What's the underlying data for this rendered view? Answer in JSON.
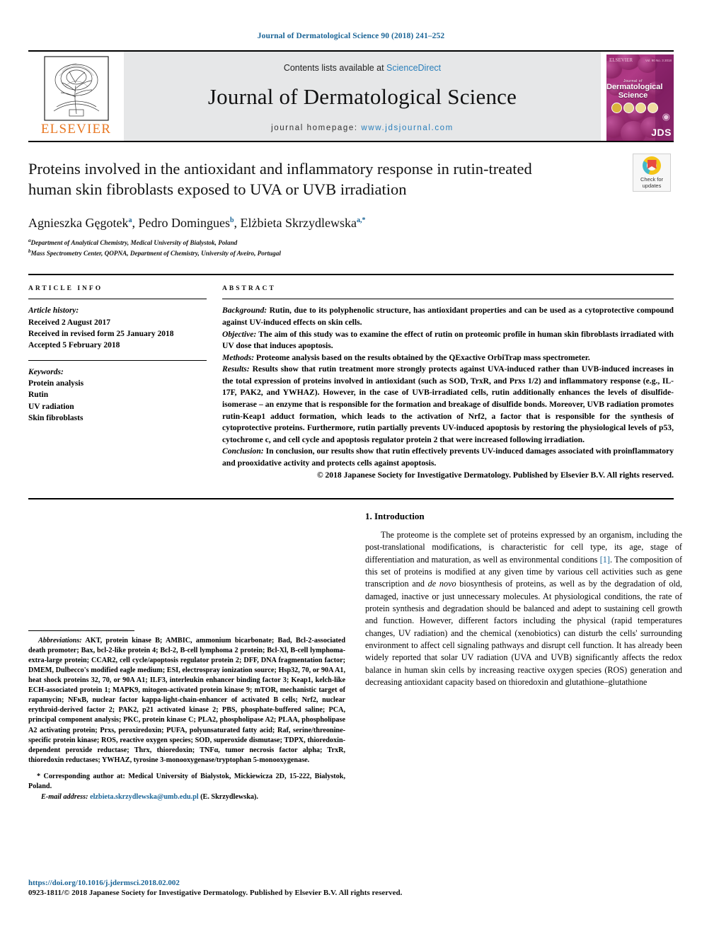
{
  "running_head": "Journal of Dermatological Science 90 (2018) 241–252",
  "masthead": {
    "publisher_name": "ELSEVIER",
    "contents_prefix": "Contents lists available at ",
    "contents_link": "ScienceDirect",
    "journal_title": "Journal of Dermatological Science",
    "homepage_prefix": "journal homepage: ",
    "homepage_url": "www.jdsjournal.com",
    "cover": {
      "title_small": "Journal of",
      "title_line1": "Dermatological",
      "title_line2": "Science",
      "acronym": "JDS",
      "publisher_small": "ELSEVIER",
      "volume_small": "Vol. 90  No. 3  2018"
    }
  },
  "article": {
    "title": "Proteins involved in the antioxidant and inflammatory response in rutin-treated human skin fibroblasts exposed to UVA or UVB irradiation",
    "crossmark_label_line1": "Check for",
    "crossmark_label_line2": "updates",
    "authors_html": "Agnieszka Gęgotek<sup>a</sup>, Pedro Domingues<sup>b</sup>, Elżbieta Skrzydlewska<sup>a,*</sup>",
    "affiliations": [
      {
        "marker": "a",
        "text": "Department of Analytical Chemistry, Medical University of Bialystok, Poland"
      },
      {
        "marker": "b",
        "text": "Mass Spectrometry Center, QOPNA, Department of Chemistry, University of Aveiro, Portugal"
      }
    ]
  },
  "article_info": {
    "heading": "ARTICLE INFO",
    "history_label": "Article history:",
    "history": [
      "Received 2 August 2017",
      "Received in revised form 25 January 2018",
      "Accepted 5 February 2018"
    ],
    "keywords_label": "Keywords:",
    "keywords": [
      "Protein analysis",
      "Rutin",
      "UV radiation",
      "Skin fibroblasts"
    ]
  },
  "abstract": {
    "heading": "ABSTRACT",
    "sections": [
      {
        "label": "Background:",
        "text": " Rutin, due to its polyphenolic structure, has antioxidant properties and can be used as a cytoprotective compound against UV-induced effects on skin cells."
      },
      {
        "label": "Objective:",
        "text": " The aim of this study was to examine the effect of rutin on proteomic profile in human skin fibroblasts irradiated with UV dose that induces apoptosis."
      },
      {
        "label": "Methods:",
        "text": " Proteome analysis based on the results obtained by the QExactive OrbiTrap mass spectrometer."
      },
      {
        "label": "Results:",
        "text": " Results show that rutin treatment more strongly protects against UVA-induced rather than UVB-induced increases in the total expression of proteins involved in antioxidant (such as SOD, TrxR, and Prxs 1/2) and inflammatory response (e.g., IL-17F, PAK2, and YWHAZ). However, in the case of UVB-irradiated cells, rutin additionally enhances the levels of disulfide-isomerase – an enzyme that is responsible for the formation and breakage of disulfide bonds. Moreover, UVB radiation promotes rutin-Keap1 adduct formation, which leads to the activation of Nrf2, a factor that is responsible for the synthesis of cytoprotective proteins. Furthermore, rutin partially prevents UV-induced apoptosis by restoring the physiological levels of p53, cytochrome c, and cell cycle and apoptosis regulator protein 2 that were increased following irradiation."
      },
      {
        "label": "Conclusion:",
        "text": " In conclusion, our results show that rutin effectively prevents UV-induced damages associated with proinflammatory and prooxidative activity and protects cells against apoptosis."
      }
    ],
    "copyright": "© 2018 Japanese Society for Investigative Dermatology. Published by Elsevier B.V. All rights reserved."
  },
  "introduction": {
    "heading": "1. Introduction",
    "paragraph": "The proteome is the complete set of proteins expressed by an organism, including the post-translational modifications, is characteristic for cell type, its age, stage of differentiation and maturation, as well as environmental conditions [1]. The composition of this set of proteins is modified at any given time by various cell activities such as gene transcription and de novo biosynthesis of proteins, as well as by the degradation of old, damaged, inactive or just unnecessary molecules. At physiological conditions, the rate of protein synthesis and degradation should be balanced and adept to sustaining cell growth and function. However, different factors including the physical (rapid temperatures changes, UV radiation) and the chemical (xenobiotics) can disturb the cells' surrounding environment to affect cell signaling pathways and disrupt cell function. It has already been widely reported that solar UV radiation (UVA and UVB) significantly affects the redox balance in human skin cells by increasing reactive oxygen species (ROS) generation and decreasing antioxidant capacity based on thioredoxin and glutathione–glutathione",
    "reference_marker": "[1]",
    "italic_phrase": "de novo"
  },
  "footnotes": {
    "abbreviations_label": "Abbreviations:",
    "abbreviations_text": " AKT, protein kinase B; AMBIC, ammonium bicarbonate; Bad, Bcl-2-associated death promoter; Bax, bcl-2-like protein 4; Bcl-2, B-cell lymphoma 2 protein; Bcl-Xl, B-cell lymphoma-extra-large protein; CCAR2, cell cycle/apoptosis regulator protein 2; DFF, DNA fragmentation factor; DMEM, Dulbecco's modified eagle medium; ESI, electrospray ionization source; Hsp32, 70, or 90A A1, heat shock proteins 32, 70, or 90A A1; ILF3, interleukin enhancer binding factor 3; Keap1, kelch-like ECH-associated protein 1; MAPK9, mitogen-activated protein kinase 9; mTOR, mechanistic target of rapamycin; NFκB, nuclear factor kappa-light-chain-enhancer of activated B cells; Nrf2, nuclear erythroid-derived factor 2; PAK2, p21 activated kinase 2; PBS, phosphate-buffered saline; PCA, principal component analysis; PKC, protein kinase C; PLA2, phospholipase A2; PLAA, phospholipase A2 activating protein; Prxs, peroxiredoxin; PUFA, polyunsaturated fatty acid; Raf, serine/threonine-specific protein kinase; ROS, reactive oxygen species; SOD, superoxide dismutase; TDPX, thioredoxin-dependent peroxide reductase; Thrx, thioredoxin; TNFα, tumor necrosis factor alpha; TrxR, thioredoxin reductases; YWHAZ, tyrosine 3-monooxygenase/tryptophan 5-monooxygenase.",
    "corresponding_marker": "*",
    "corresponding_text": " Corresponding author at: Medical University of Bialystok, Mickiewicza 2D, 15-222, Bialystok, Poland.",
    "email_label": "E-mail address:",
    "email_address": "elzbieta.skrzydlewska@umb.edu.pl",
    "email_suffix": " (E. Skrzydlewska)."
  },
  "page_footer": {
    "doi": "https://doi.org/10.1016/j.jdermsci.2018.02.002",
    "issn_line": "0923-1811/© 2018 Japanese Society for Investigative Dermatology. Published by Elsevier B.V. All rights reserved."
  },
  "colors": {
    "link": "#1a6496",
    "sciencedirect": "#2a7fbb",
    "elsevier_orange": "#e87722",
    "masthead_bg": "#e6e7e8",
    "cover_magenta": "#9c2a72"
  }
}
